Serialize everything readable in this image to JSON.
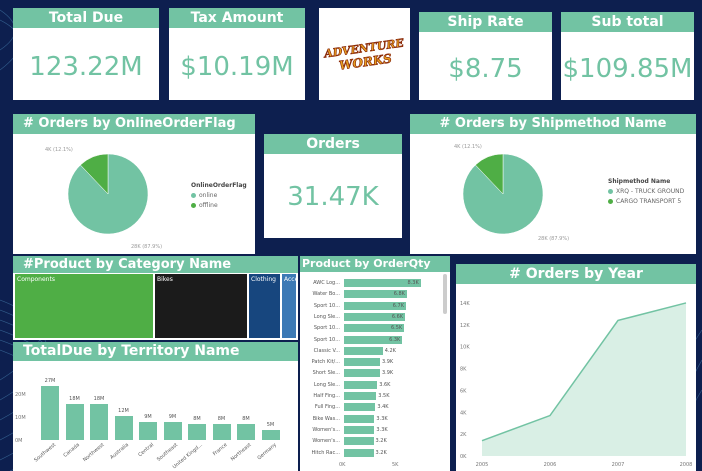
{
  "colors": {
    "accent": "#72c3a3",
    "accent_dark": "#5cb08e",
    "background": "#0d1f4f",
    "green": "#4fae45",
    "black": "#1b1b1b",
    "navy": "#17467e",
    "blue": "#3c79b5"
  },
  "kpis": {
    "total_due": {
      "title": "Total Due",
      "value": "123.22M"
    },
    "tax_amount": {
      "title": "Tax Amount",
      "value": "$10.19M"
    },
    "ship_rate": {
      "title": "Ship Rate",
      "value": "$8.75"
    },
    "sub_total": {
      "title": "Sub total",
      "value": "$109.85M"
    },
    "orders": {
      "title": "Orders",
      "value": "31.47K"
    }
  },
  "logo": {
    "line1": "ADVENTURE",
    "line2": "WORKS"
  },
  "online_flag": {
    "title": "# Orders by OnlineOrderFlag",
    "legend_title": "OnlineOrderFlag",
    "legend": [
      "online",
      "offline"
    ],
    "small_label": "4K (12.1%)",
    "big_label": "28K (87.9%)",
    "chart_data": {
      "type": "pie",
      "labels": [
        "online",
        "offline"
      ],
      "values": [
        87.9,
        12.1
      ]
    }
  },
  "shipmethod": {
    "title": "# Orders by Shipmethod Name",
    "legend_title": "Shipmethod Name",
    "legend": [
      "XRQ - TRUCK GROUND",
      "CARGO TRANSPORT 5"
    ],
    "small_label": "4K (12.1%)",
    "big_label": "28K (87.9%)",
    "chart_data": {
      "type": "pie",
      "labels": [
        "XRQ - TRUCK GROUND",
        "CARGO TRANSPORT 5"
      ],
      "values": [
        87.9,
        12.1
      ]
    }
  },
  "category": {
    "title": "#Product by Category Name",
    "cells": [
      "Components",
      "Bikes",
      "Clothing",
      "Acce..."
    ]
  },
  "territory": {
    "title": "TotalDue by Territory Name",
    "ytick_labels": [
      "20M",
      "10M",
      "0M"
    ],
    "chart_data": {
      "type": "bar",
      "categories": [
        "Southwest",
        "Canada",
        "Northwest",
        "Australia",
        "Central",
        "Southeast",
        "United Kingd...",
        "France",
        "Northeast",
        "Germany"
      ],
      "values": [
        27,
        18,
        18,
        12,
        9,
        9,
        8,
        8,
        8,
        5
      ],
      "value_labels": [
        "27M",
        "18M",
        "18M",
        "12M",
        "9M",
        "9M",
        "8M",
        "8M",
        "8M",
        "5M"
      ],
      "ylim": [
        0,
        30
      ]
    }
  },
  "orderqty": {
    "title": "Product by OrderQty",
    "xtick_labels": [
      "0K",
      "5K"
    ],
    "chart_data": {
      "type": "bar",
      "orientation": "horizontal",
      "categories": [
        "AWC Log...",
        "Water Bo...",
        "Sport 10...",
        "Long Sle...",
        "Sport 10...",
        "Sport 10...",
        "Classic V...",
        "Patch Kit/...",
        "Short Sle...",
        "Long Sle...",
        "Half Fing...",
        "Full Fing...",
        "Bike Was...",
        "Women's...",
        "Women's...",
        "Hitch Rac..."
      ],
      "values": [
        8.3,
        6.8,
        6.7,
        6.6,
        6.5,
        6.3,
        4.2,
        3.9,
        3.9,
        3.6,
        3.5,
        3.4,
        3.3,
        3.3,
        3.2,
        3.2
      ],
      "value_labels": [
        "8.3K",
        "6.8K",
        "6.7K",
        "6.6K",
        "6.5K",
        "6.3K",
        "4.2K",
        "3.9K",
        "3.9K",
        "3.6K",
        "3.5K",
        "3.4K",
        "3.3K",
        "3.3K",
        "3.2K",
        "3.2K"
      ],
      "xlim": [
        0,
        9
      ]
    }
  },
  "orders_year": {
    "title": "# Orders by Year",
    "ytick_labels": [
      "14K",
      "12K",
      "10K",
      "8K",
      "6K",
      "4K",
      "2K",
      "0K"
    ],
    "chart_data": {
      "type": "area",
      "x": [
        "2005",
        "2006",
        "2007",
        "2008"
      ],
      "values": [
        1.4,
        3.7,
        12.4,
        14.0
      ],
      "ylim": [
        0,
        15
      ]
    }
  }
}
